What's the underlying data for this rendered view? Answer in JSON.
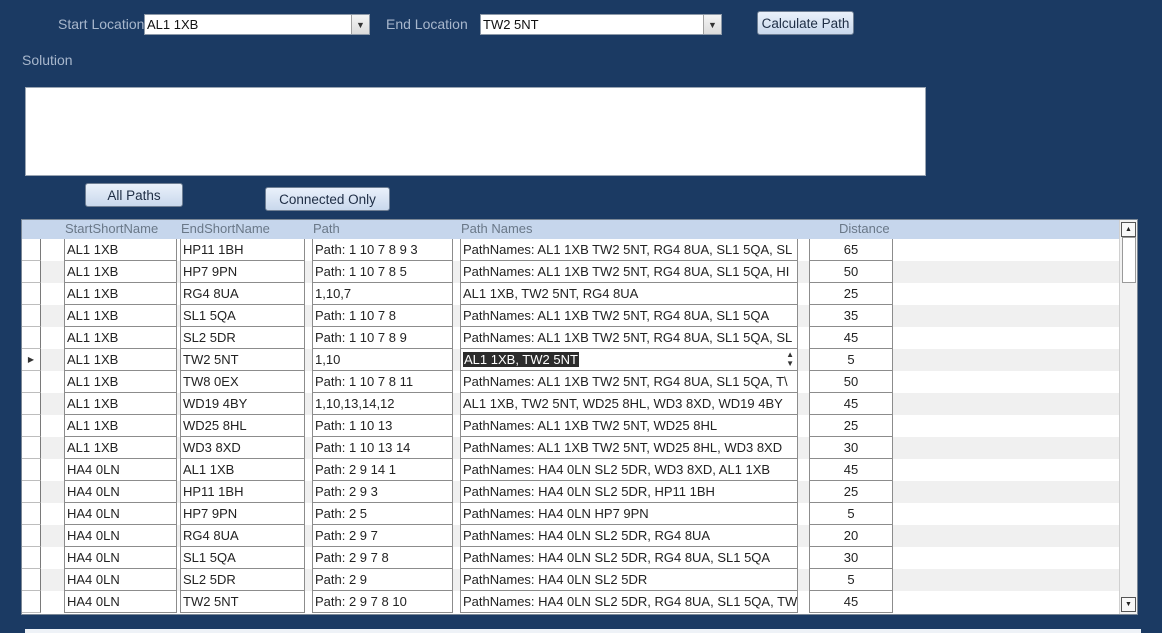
{
  "form": {
    "start_label": "Start Location",
    "start_value": "AL1 1XB",
    "end_label": "End Location",
    "end_value": "TW2 5NT",
    "calculate_label": "Calculate Path",
    "solution_label": "Solution",
    "solution_text": "",
    "all_paths_label": "All Paths",
    "connected_only_label": "Connected Only"
  },
  "grid": {
    "headers": {
      "start": "StartShortName",
      "end": "EndShortName",
      "path": "Path",
      "names": "Path Names",
      "distance": "Distance"
    },
    "current_row": 5,
    "rows": [
      {
        "start": "AL1 1XB",
        "end": "HP11 1BH",
        "path": "Path: 1 10 7 8 9 3",
        "names": "PathNames: AL1 1XB TW2 5NT, RG4 8UA, SL1 5QA, SL",
        "distance": "65"
      },
      {
        "start": "AL1 1XB",
        "end": "HP7 9PN",
        "path": "Path: 1 10 7 8 5",
        "names": "PathNames: AL1 1XB TW2 5NT, RG4 8UA, SL1 5QA, HI",
        "distance": "50"
      },
      {
        "start": "AL1 1XB",
        "end": "RG4 8UA",
        "path": "1,10,7",
        "names": "AL1 1XB, TW2 5NT, RG4 8UA",
        "distance": "25"
      },
      {
        "start": "AL1 1XB",
        "end": "SL1 5QA",
        "path": "Path: 1 10 7 8",
        "names": "PathNames: AL1 1XB TW2 5NT, RG4 8UA, SL1 5QA",
        "distance": "35"
      },
      {
        "start": "AL1 1XB",
        "end": "SL2 5DR",
        "path": "Path: 1 10 7 8 9",
        "names": "PathNames: AL1 1XB TW2 5NT, RG4 8UA, SL1 5QA, SL",
        "distance": "45"
      },
      {
        "start": "AL1 1XB",
        "end": "TW2 5NT",
        "path": "1,10",
        "names": "AL1 1XB, TW2 5NT",
        "distance": "5"
      },
      {
        "start": "AL1 1XB",
        "end": "TW8 0EX",
        "path": "Path: 1 10 7 8 11",
        "names": "PathNames: AL1 1XB TW2 5NT, RG4 8UA, SL1 5QA, T\\",
        "distance": "50"
      },
      {
        "start": "AL1 1XB",
        "end": "WD19 4BY",
        "path": "1,10,13,14,12",
        "names": "AL1 1XB, TW2 5NT, WD25 8HL, WD3 8XD, WD19 4BY",
        "distance": "45"
      },
      {
        "start": "AL1 1XB",
        "end": "WD25 8HL",
        "path": "Path: 1 10 13",
        "names": "PathNames: AL1 1XB TW2 5NT, WD25 8HL",
        "distance": "25"
      },
      {
        "start": "AL1 1XB",
        "end": "WD3 8XD",
        "path": "Path: 1 10 13 14",
        "names": "PathNames: AL1 1XB TW2 5NT, WD25 8HL, WD3 8XD",
        "distance": "30"
      },
      {
        "start": "HA4 0LN",
        "end": "AL1 1XB",
        "path": "Path: 2 9 14 1",
        "names": "PathNames: HA4 0LN SL2 5DR, WD3 8XD, AL1 1XB",
        "distance": "45"
      },
      {
        "start": "HA4 0LN",
        "end": "HP11 1BH",
        "path": "Path: 2 9 3",
        "names": "PathNames: HA4 0LN SL2 5DR, HP11 1BH",
        "distance": "25"
      },
      {
        "start": "HA4 0LN",
        "end": "HP7 9PN",
        "path": "Path: 2 5",
        "names": "PathNames: HA4 0LN HP7 9PN",
        "distance": "5"
      },
      {
        "start": "HA4 0LN",
        "end": "RG4 8UA",
        "path": "Path: 2 9 7",
        "names": "PathNames: HA4 0LN SL2 5DR, RG4 8UA",
        "distance": "20"
      },
      {
        "start": "HA4 0LN",
        "end": "SL1 5QA",
        "path": "Path: 2 9 7 8",
        "names": "PathNames: HA4 0LN SL2 5DR, RG4 8UA, SL1 5QA",
        "distance": "30"
      },
      {
        "start": "HA4 0LN",
        "end": "SL2 5DR",
        "path": "Path: 2 9",
        "names": "PathNames: HA4 0LN SL2 5DR",
        "distance": "5"
      },
      {
        "start": "HA4 0LN",
        "end": "TW2 5NT",
        "path": "Path: 2 9 7 8 10",
        "names": "PathNames: HA4 0LN SL2 5DR, RG4 8UA, SL1 5QA, TW",
        "distance": "45"
      }
    ]
  }
}
